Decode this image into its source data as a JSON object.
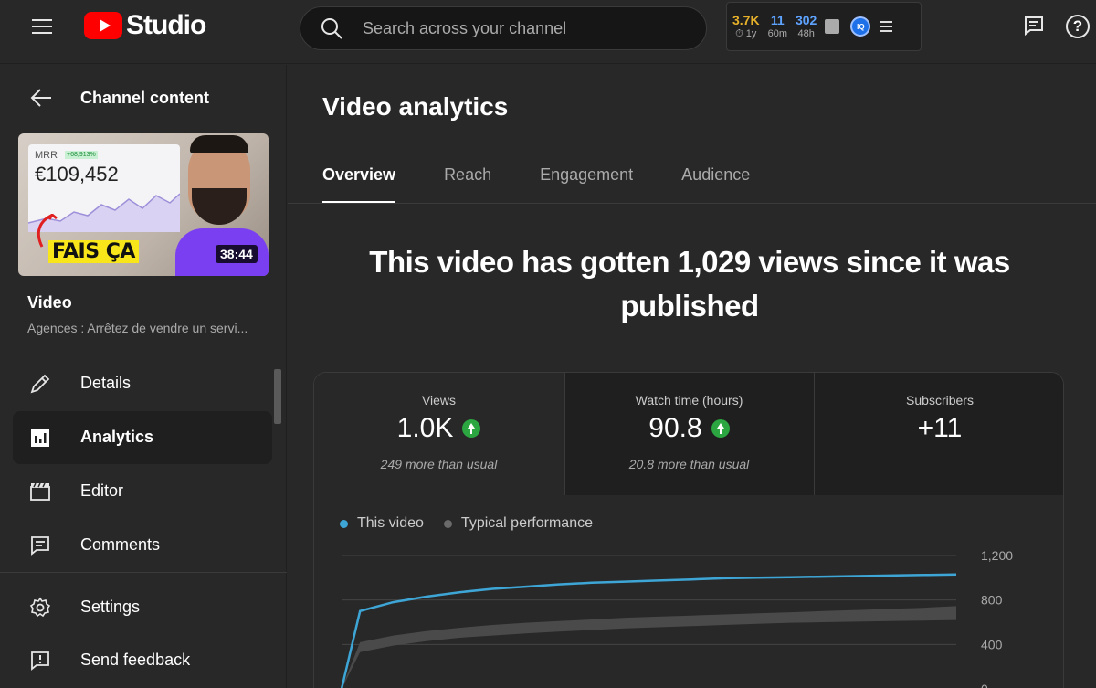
{
  "topbar": {
    "logo_text": "Studio",
    "search_placeholder": "Search across your channel",
    "stats": [
      {
        "value": "3.7K",
        "label": "⏱ 1y",
        "color": "#e6b02a"
      },
      {
        "value": "11",
        "label": "60m",
        "color": "#5ea3ff"
      },
      {
        "value": "302",
        "label": "48h",
        "color": "#5ea3ff"
      }
    ],
    "iq_label": "IQ"
  },
  "sidebar": {
    "back_label": "Channel content",
    "thumbnail": {
      "mrr_label": "MRR",
      "mrr_badge": "+68,913%",
      "amount": "€109,452",
      "caption": "FAIS ÇA",
      "duration": "38:44"
    },
    "video_label": "Video",
    "video_title": "Agences : Arrêtez de vendre un servi...",
    "items": [
      {
        "label": "Details"
      },
      {
        "label": "Analytics"
      },
      {
        "label": "Editor"
      },
      {
        "label": "Comments"
      },
      {
        "label": "Settings"
      },
      {
        "label": "Send feedback"
      }
    ]
  },
  "main": {
    "title": "Video analytics",
    "tabs": [
      {
        "label": "Overview"
      },
      {
        "label": "Reach"
      },
      {
        "label": "Engagement"
      },
      {
        "label": "Audience"
      }
    ],
    "headline": "This video has gotten 1,029 views since it was published",
    "metrics": [
      {
        "label": "Views",
        "value": "1.0K",
        "sub": "249 more than usual"
      },
      {
        "label": "Watch time (hours)",
        "value": "90.8",
        "sub": "20.8 more than usual"
      },
      {
        "label": "Subscribers",
        "value": "+11",
        "sub": ""
      }
    ]
  },
  "chart_data": {
    "type": "line",
    "series": [
      {
        "name": "This video",
        "color": "#3ea6d6",
        "values": [
          0,
          700,
          780,
          830,
          870,
          900,
          920,
          940,
          955,
          965,
          975,
          985,
          995,
          1000,
          1005,
          1010,
          1015,
          1020,
          1025,
          1029
        ]
      },
      {
        "name": "Typical performance",
        "color": "#6a6a6a",
        "band_low": [
          0,
          330,
          390,
          430,
          460,
          480,
          500,
          515,
          530,
          545,
          555,
          565,
          575,
          585,
          595,
          600,
          605,
          610,
          615,
          620
        ],
        "band_high": [
          0,
          420,
          480,
          520,
          550,
          575,
          595,
          610,
          625,
          640,
          650,
          660,
          670,
          680,
          690,
          700,
          710,
          720,
          730,
          745
        ]
      }
    ],
    "yticks": [
      "1,200",
      "800",
      "400",
      "0"
    ],
    "ylim": [
      0,
      1200
    ]
  }
}
